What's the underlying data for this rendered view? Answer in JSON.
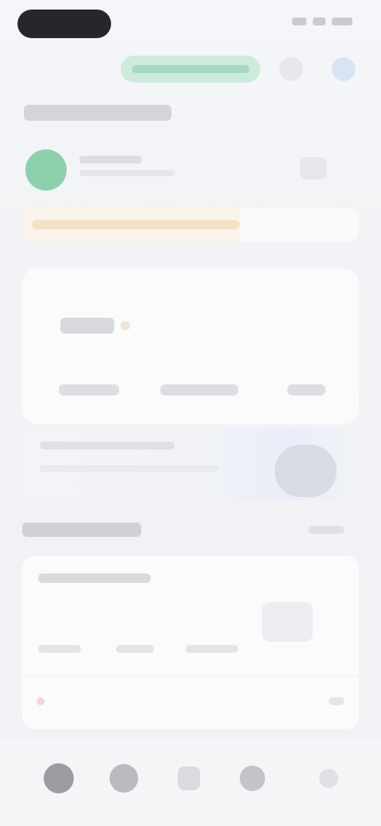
{
  "status_bar": {},
  "header": {},
  "profile": {},
  "notice": {},
  "stats": {},
  "banner": {},
  "section": {},
  "list": {},
  "nav": {
    "items": [
      {
        "icon": "home-icon"
      },
      {
        "icon": "discover-icon"
      },
      {
        "icon": "add-icon"
      },
      {
        "icon": "messages-icon"
      },
      {
        "icon": "profile-icon"
      }
    ]
  },
  "colors": {
    "accent_green": "#8fd0ac",
    "promo_green": "#cdebdc",
    "notice_bg": "#fbf4ea",
    "background": "#f2f3f6"
  }
}
